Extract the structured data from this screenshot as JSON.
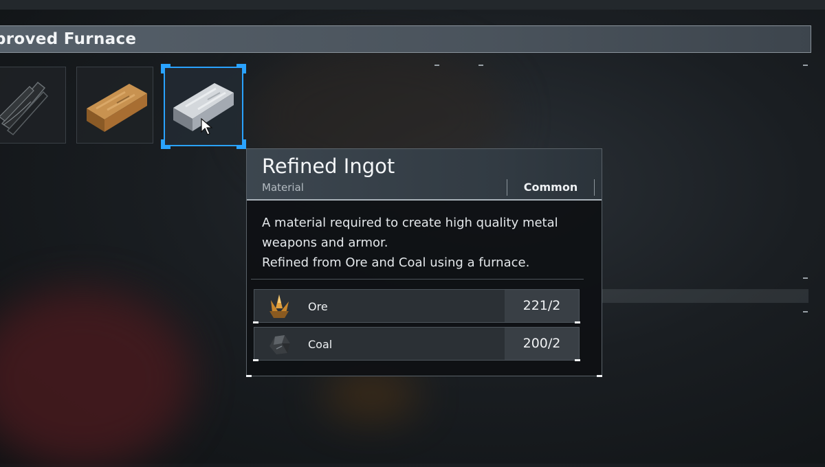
{
  "station": {
    "title": "proved Furnace"
  },
  "items": [
    {
      "name": "fiber-bundle-icon",
      "selected": false
    },
    {
      "name": "copper-ingot-icon",
      "selected": false
    },
    {
      "name": "refined-ingot-icon",
      "selected": true
    }
  ],
  "tooltip": {
    "title": "Refined Ingot",
    "category": "Material",
    "rarity": "Common",
    "description": [
      "A material required to create high quality metal",
      "weapons and armor.",
      "Refined from Ore and Coal using a furnace."
    ],
    "materials": [
      {
        "icon": "ore-icon",
        "name": "Ore",
        "count": "221/2"
      },
      {
        "icon": "coal-icon",
        "name": "Coal",
        "count": "200/2"
      }
    ]
  },
  "colors": {
    "accent": "#2aa3ff",
    "panel": "#0e1014",
    "header": "#3c464f"
  }
}
